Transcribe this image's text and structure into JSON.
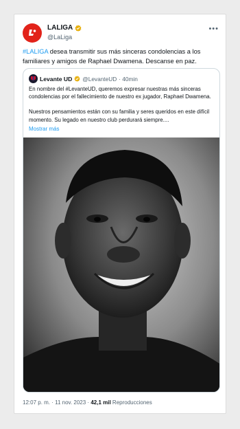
{
  "account": {
    "name": "LALIGA",
    "handle": "@LaLiga"
  },
  "tweet": {
    "hashtag": "#LALIGA",
    "text": " desea transmitir sus más sinceras condolencias a los familiares y amigos de Raphael Dwamena. Descanse en paz."
  },
  "quote": {
    "name": "Levante UD",
    "handle": "@LevanteUD",
    "time": "· 40min",
    "paragraph1": "En nombre del #LevanteUD, queremos expresar nuestras más sinceras condolencias por el fallecimiento de nuestro ex jugador, Raphael Dwamena.",
    "paragraph2": "Nuestros pensamientos están con su familia y seres queridos en este difícil momento. Su legado en nuestro club perdurará siempre....",
    "show_more": "Mostrar más"
  },
  "footer": {
    "time": "12:07 p. m. · 11 nov. 2023 · ",
    "views": "42,1 mil",
    "views_label": " Reproducciones"
  },
  "colors": {
    "brand": "#e2231a",
    "link": "#1d9bf0",
    "verified": "#e8b00f"
  },
  "icons": {
    "logo": "laliga-logo",
    "verified": "verified-badge-icon",
    "more": "more-options-icon"
  }
}
